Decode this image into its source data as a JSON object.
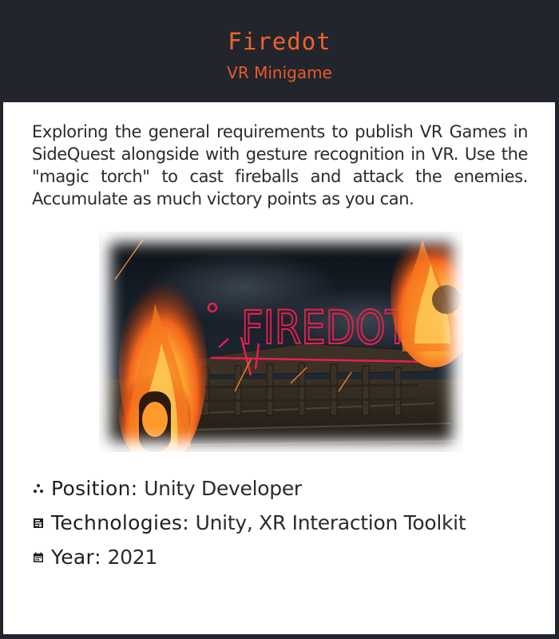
{
  "header": {
    "title": "Firedot",
    "subtitle": "VR Minigame"
  },
  "project": {
    "description": "Exploring the general requirements to publish VR Games in SideQuest alongside with gesture recognition in VR. Use the \"magic torch\" to cast fireballs and attack the enemies. Accumulate as much victory points as you can.",
    "screenshot_sign_text": "FIREDOT"
  },
  "details": [
    {
      "icon": "people-icon",
      "key": "Position",
      "separator": ":",
      "value": "Unity Developer"
    },
    {
      "icon": "document-icon",
      "key": "Technologies",
      "separator": ":",
      "value": "Unity, XR Interaction Toolkit"
    },
    {
      "icon": "calendar-icon",
      "key": "Year",
      "separator": ":",
      "value": "2021"
    }
  ],
  "colors": {
    "background": "#23252d",
    "accent": "#f0622a",
    "card": "#ffffff",
    "text": "#2b2b2b",
    "neon_sign": "#e8204e"
  }
}
